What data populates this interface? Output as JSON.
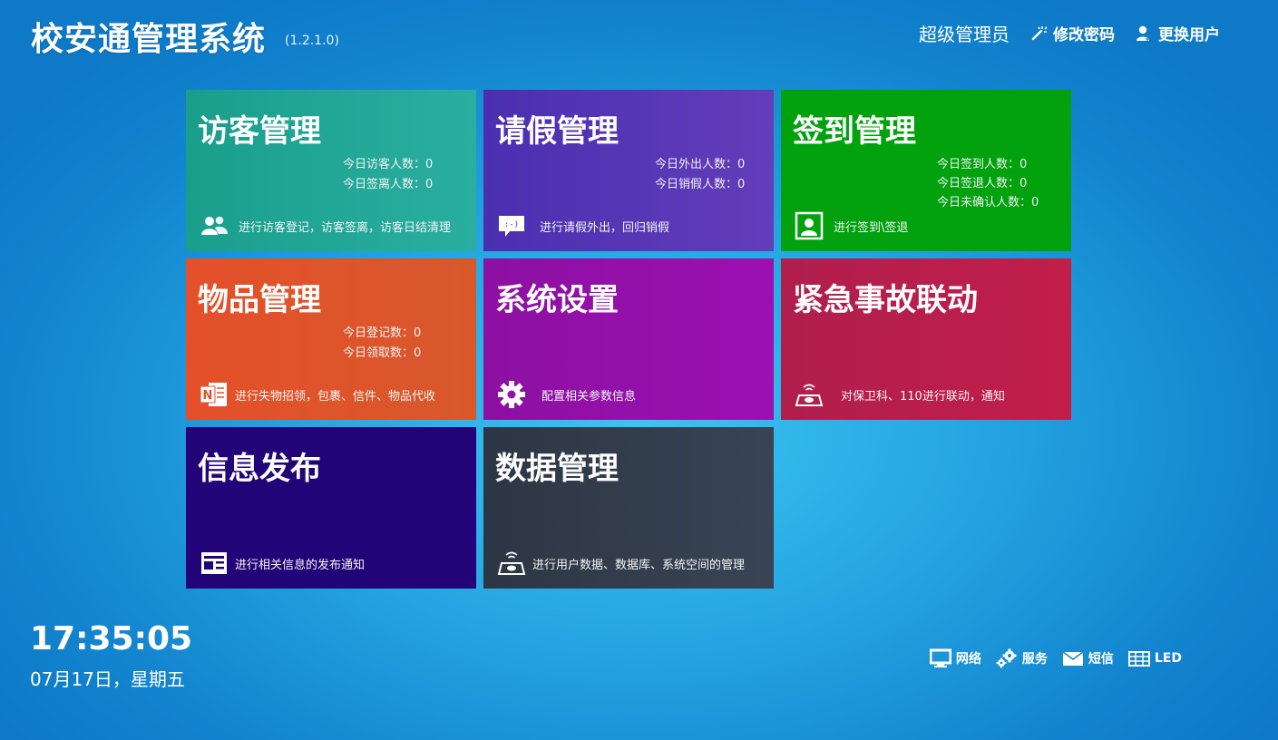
{
  "header": {
    "title": "校安通管理系统",
    "version": "(1.2.1.0)",
    "user_role": "超级管理员",
    "change_password": "修改密码",
    "switch_user": "更换用户"
  },
  "tiles": {
    "visitor": {
      "title": "访客管理",
      "stats": [
        "今日访客人数：0",
        "今日签离人数：0"
      ],
      "footer": "进行访客登记，访客签离，访客日结清理",
      "icon": "users-icon",
      "color": "#1fa494"
    },
    "leave": {
      "title": "请假管理",
      "stats": [
        "今日外出人数：0",
        "今日销假人数：0"
      ],
      "footer": "进行请假外出，回归销假",
      "icon": "chat-bubble-icon",
      "color": "#5535b4"
    },
    "signin": {
      "title": "签到管理",
      "stats": [
        "今日签到人数：0",
        "今日签退人数：0",
        "今日未确认人数：0"
      ],
      "footer": "进行签到\\签退",
      "icon": "contact-card-icon",
      "color": "#02a10e"
    },
    "goods": {
      "title": "物品管理",
      "stats": [
        "今日登记数：0",
        "今日领取数：0"
      ],
      "footer": "进行失物招领，包裹、信件、物品代收",
      "icon": "notebook-icon",
      "color": "#e0532b"
    },
    "settings": {
      "title": "系统设置",
      "footer": "配置相关参数信息",
      "icon": "gear-icon",
      "color": "#9410aa"
    },
    "emergency": {
      "title": "紧急事故联动",
      "footer": "对保卫科、110进行联动，通知",
      "icon": "alarm-icon",
      "color": "#b81e4c"
    },
    "info": {
      "title": "信息发布",
      "footer": "进行相关信息的发布通知",
      "icon": "newspaper-icon",
      "color": "#220478"
    },
    "data": {
      "title": "数据管理",
      "footer": "进行用户数据、数据库、系统空间的管理",
      "icon": "database-broadcast-icon",
      "color": "#323d4c"
    }
  },
  "clock": {
    "time": "17:35:05",
    "date": "07月17日，星期五"
  },
  "status": {
    "network": "网络",
    "service": "服务",
    "sms": "短信",
    "led": "LED"
  }
}
